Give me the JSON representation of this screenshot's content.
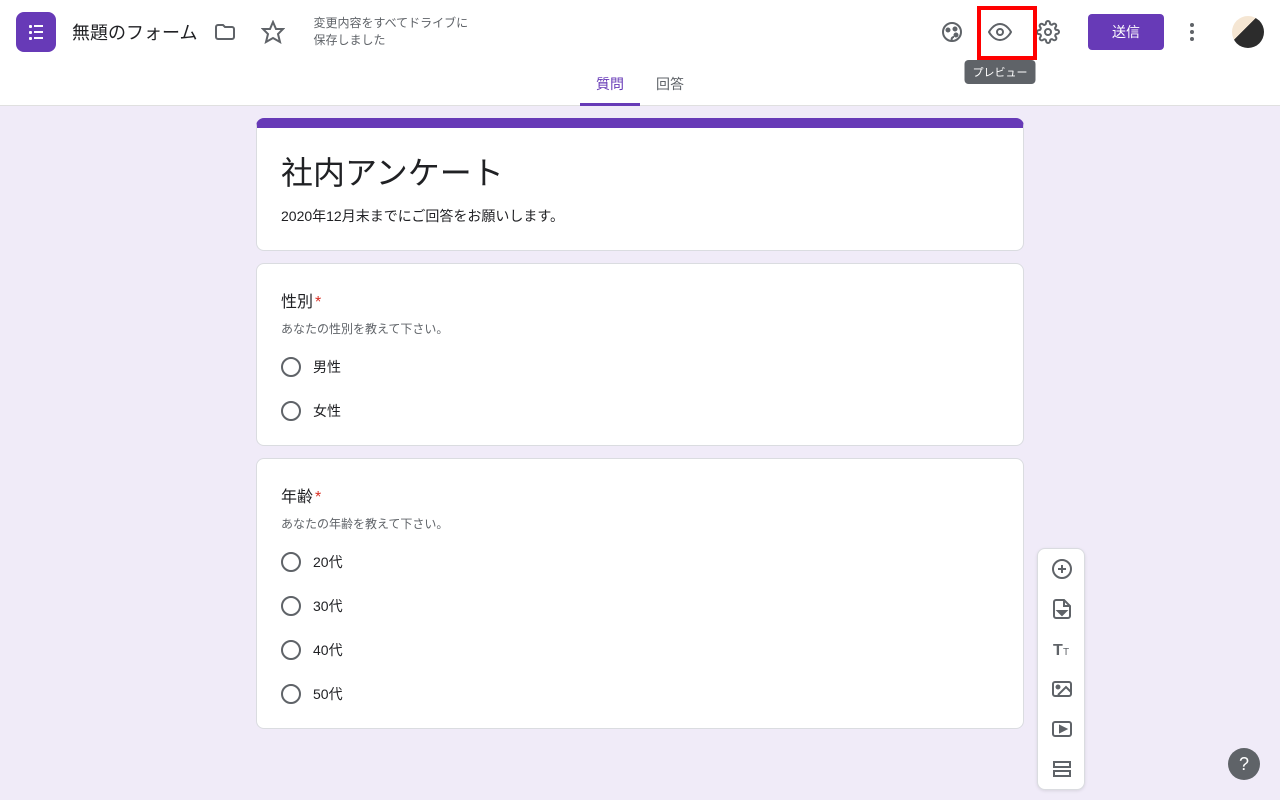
{
  "header": {
    "title": "無題のフォーム",
    "save_status": "変更内容をすべてドライブに保存しました",
    "send_label": "送信",
    "preview_tooltip": "プレビュー"
  },
  "tabs": {
    "questions": "質問",
    "responses": "回答"
  },
  "form": {
    "title": "社内アンケート",
    "description": "2020年12月末までにご回答をお願いします。"
  },
  "questions": [
    {
      "title": "性別",
      "description": "あなたの性別を教えて下さい。",
      "options": [
        "男性",
        "女性"
      ]
    },
    {
      "title": "年齢",
      "description": "あなたの年齢を教えて下さい。",
      "options": [
        "20代",
        "30代",
        "40代",
        "50代"
      ]
    }
  ]
}
